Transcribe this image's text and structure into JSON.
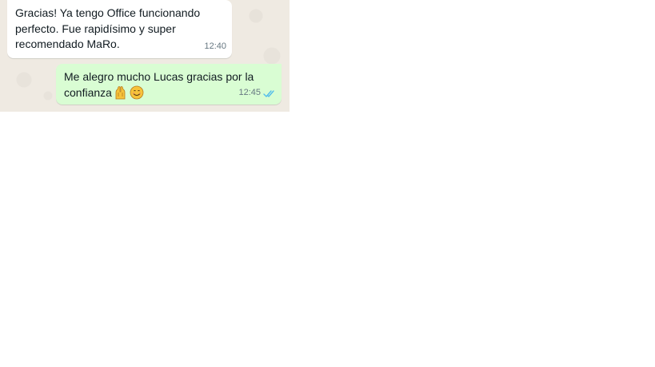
{
  "chat": {
    "messages": [
      {
        "direction": "incoming",
        "text": "Gracias! Ya tengo Office funcionando perfecto. Fue rapidísimo y super recomendado MaRo.",
        "time": "12:40"
      },
      {
        "direction": "outgoing",
        "text": "Me alegro mucho Lucas gracias por la confianza",
        "emojis": [
          "raising-hands-emoji",
          "smiling-face-emoji"
        ],
        "time": "12:45",
        "status": "read",
        "status_icon": "double-check-icon"
      }
    ]
  },
  "colors": {
    "chat_background": "#efeae2",
    "incoming_bubble": "#ffffff",
    "outgoing_bubble": "#d9fdd3",
    "read_check": "#53bdeb",
    "timestamp": "#667781"
  }
}
